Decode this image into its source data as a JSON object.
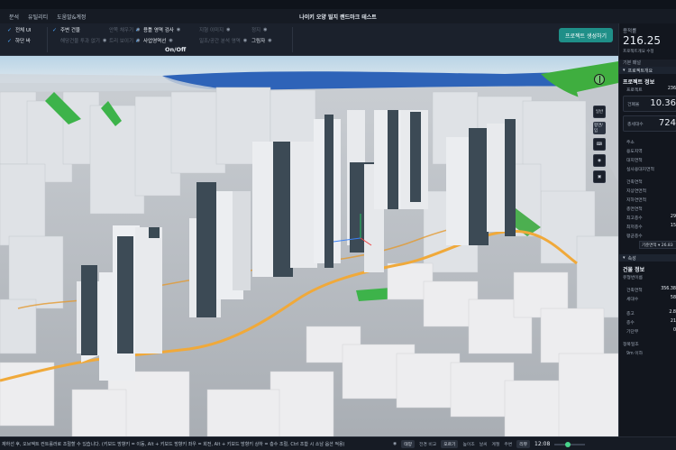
{
  "window": {
    "title": "나이키 오양 빌지 랜드마크 테스트"
  },
  "menu": [
    {
      "label": "분석"
    },
    {
      "label": "유틸리티"
    },
    {
      "label": "도움말&계정"
    }
  ],
  "toolbar": {
    "col1": [
      {
        "label": "전체 UI",
        "checked": true
      },
      {
        "label": "하단 바",
        "checked": true
      }
    ],
    "col2": [
      {
        "label": "주변 건물",
        "checked": true
      },
      {
        "label": "해당건물 투과 없기",
        "checked": false
      }
    ],
    "col3": [
      {
        "label": "안쪽 채우기",
        "checked": false
      },
      {
        "label": "트리 보이기",
        "checked": false
      }
    ],
    "col4": [
      {
        "label": "용틀 영역 검사",
        "checked": false
      },
      {
        "label": "사업영역선",
        "checked": true
      }
    ],
    "col5": [
      {
        "label": "지형 이미지",
        "checked": false
      },
      {
        "label": "일조/공간 분석 영역",
        "checked": false
      }
    ],
    "col6": [
      {
        "label": "정지",
        "checked": false
      },
      {
        "label": "그림자",
        "checked": false
      }
    ],
    "onoff_label": "On/Off",
    "generate_button": "프로젝트 생성하기"
  },
  "right_panel": {
    "header": "용적률",
    "big_value": "216.25",
    "sub": "프로젝트개요 수정",
    "tab_label": "기본 패널",
    "section1": "프로젝트개요",
    "project_title": "프로젝트 정보",
    "project_no_key": "프로젝트",
    "project_no_val": "236",
    "coverage_key": "건폐율",
    "coverage_val": "10.36",
    "households_key": "총세대수",
    "households_val": "724",
    "address_key": "주소",
    "zone_key": "용도지역",
    "area_key": "대지면적",
    "real_area_key": "실사용대지면적",
    "floor_key": "건축연적",
    "above_key": "지상연면적",
    "below_key": "지하연면적",
    "total_key": "총면연적",
    "max_floor_key": "최고층수",
    "max_floor_val": "29",
    "min_floor_key": "최저층수",
    "min_floor_val": "15",
    "avg_key": "평균층수",
    "select_label": "기준면적",
    "select_val": "26.83",
    "section2": "속성",
    "building_title": "건물 정보",
    "building_sub": "유형번이름",
    "b_area_key": "건축면적",
    "b_area_val": "356.38",
    "b_house_key": "세대수",
    "b_house_val": "58",
    "b_floor_key": "층고",
    "b_floor_val": "2.8",
    "b_floors_key": "층수",
    "b_floors_val": "21",
    "b_pilotis_key": "기단부",
    "b_pilotis_val": "0",
    "sun_key": "정북일조",
    "sun_val": "9m 이하"
  },
  "map_tools": [
    {
      "label": "일반"
    },
    {
      "label": "평면/입"
    },
    {
      "label": "keyboard"
    },
    {
      "label": "pin"
    },
    {
      "label": "camera"
    }
  ],
  "statusbar": {
    "hint": "재하선 후, 오브젝트 컨트롤러로 조절할 수 있습니다. (키보드 방향키 = 이동, Alt + 키보드 방향키 좌우 = 회전, Alt + 키보드 방향키 상하 = 층수 조절, Ctrl 조합 시 소남 옵션 적용)",
    "items": [
      "태양",
      "전경 비교",
      "오르기",
      "높이조",
      "날씨",
      "계절",
      "주변",
      "리뷰"
    ],
    "time": "12:08"
  }
}
